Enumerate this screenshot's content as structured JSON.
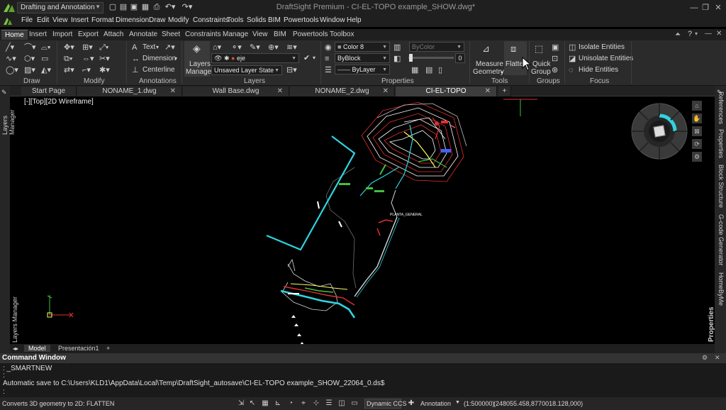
{
  "app": {
    "workspace": "Drafting and Annotation",
    "window_title": "DraftSight Premium - CI-EL-TOPO example_SHOW.dwg*",
    "help_glyph": "?"
  },
  "menu": [
    "File",
    "Edit",
    "View",
    "Insert",
    "Format",
    "Dimension",
    "Draw",
    "Modify",
    "Constraints",
    "Tools",
    "Solids",
    "BIM",
    "Powertools",
    "Window",
    "Help"
  ],
  "ribbon_tabs": [
    "Home",
    "Insert",
    "Import",
    "Export",
    "Attach",
    "Annotate",
    "Sheet",
    "Constraints",
    "Manage",
    "View",
    "BIM",
    "Powertools",
    "Toolbox"
  ],
  "ribbon": {
    "groups": [
      "Draw",
      "Modify",
      "Annotations",
      "Layers",
      "Properties",
      "Tools",
      "Groups",
      "Focus"
    ],
    "annotations": {
      "text": "Text",
      "dimension": "Dimension",
      "centerline": "Centerline"
    },
    "layers": {
      "manager_line1": "Layers",
      "manager_line2": "Manager",
      "current_layer": "eje",
      "layer_state": "Unsaved Layer State"
    },
    "properties": {
      "color": "Color 8",
      "bycolor": "ByColor",
      "linetype": "ByBlock",
      "lineweight": "ByLayer",
      "transparency": "0"
    },
    "tools": {
      "measure_line1": "Measure",
      "measure_line2": "Geometry",
      "flatten": "Flatten"
    },
    "groups_panel": {
      "quick_line1": "Quick",
      "quick_line2": "Group"
    },
    "focus": {
      "isolate": "Isolate Entities",
      "unisolate": "Unisolate Entities",
      "hide": "Hide Entities"
    }
  },
  "doc_tabs": [
    "Start Page",
    "NONAME_1.dwg",
    "Wall Base.dwg",
    "NONAME_2.dwg",
    "CI-EL-TOPO ex...ple_SHOW.dwg*"
  ],
  "viewport": {
    "label": "[-][Top][2D Wireframe]",
    "drawing_label": "PLANTA_GENERAL"
  },
  "left_panel": {
    "top_label": "Layers Manager",
    "bottom_label": "Layers Manager"
  },
  "right_panel": [
    "References",
    "Properties",
    "Block Structure",
    "G-code Generator",
    "HomeByMe",
    "Properties"
  ],
  "model_tabs": [
    "Model",
    "Presentación1"
  ],
  "command": {
    "title": "Command Window",
    "lines": [
      ": _SMARTNEW",
      ":",
      "Automatic save to C:\\Users\\KLD1\\AppData\\Local\\Temp\\DraftSight_autosave\\CI-EL-TOPO example_SHOW_22064_0.ds$",
      ":"
    ]
  },
  "status": {
    "message": "Converts 3D geometry to 2D: FLATTEN",
    "ccs": "Dynamic CCS",
    "annotation": "Annotation",
    "scale": "(1:500000)",
    "coords": "(248055.458,8770018.128,000)"
  },
  "colors": {
    "cyan": "#2fd4e0",
    "red": "#e03030",
    "green": "#40c040",
    "white": "#ffffff"
  }
}
